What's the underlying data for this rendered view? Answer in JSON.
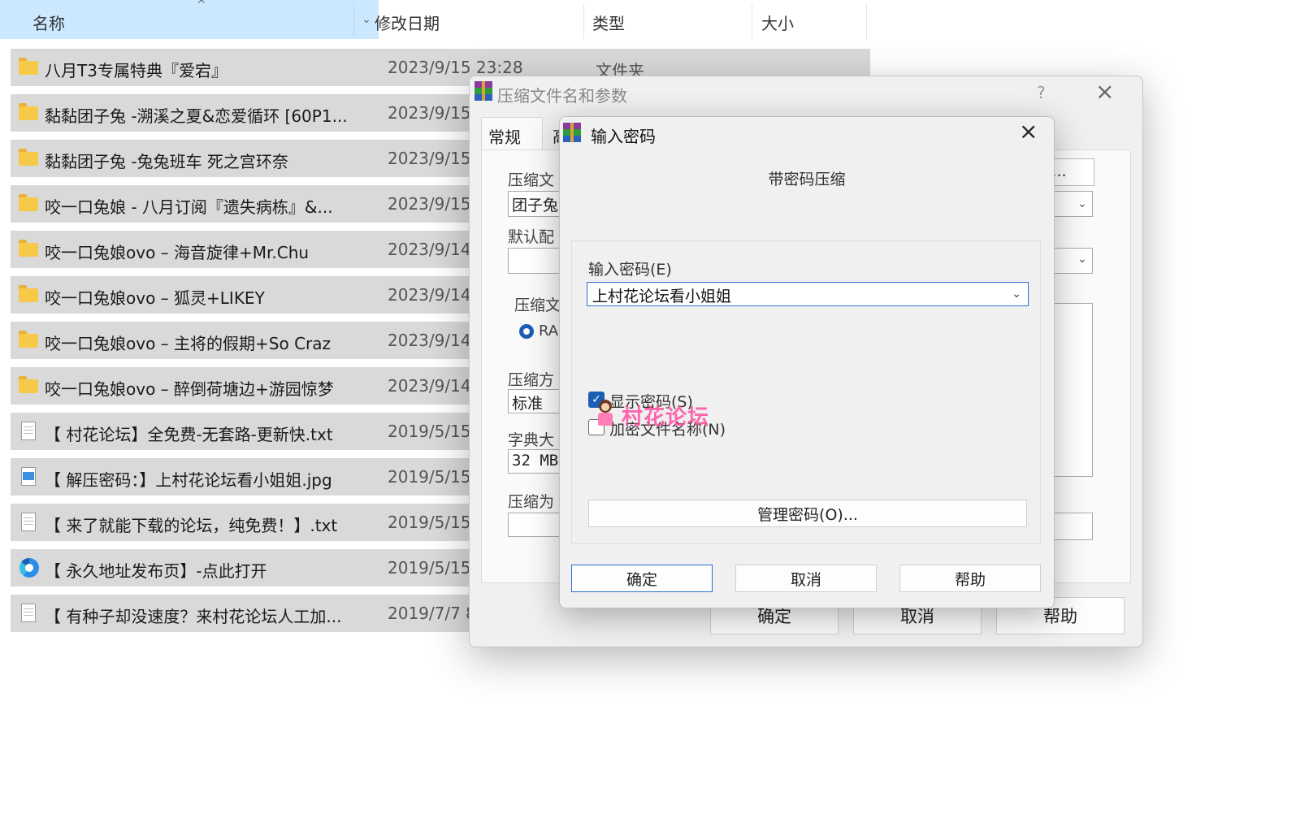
{
  "header": {
    "name": "名称",
    "date": "修改日期",
    "type": "类型",
    "size": "大小"
  },
  "files": [
    {
      "name": "八月T3专属特典『爱宕』",
      "date": "2023/9/15 23:28",
      "type": "文件夹",
      "icon": "folder-icon"
    },
    {
      "name": "黏黏团子兔 -溯溪之夏&恋爱循环 [60P1...",
      "date": "2023/9/15",
      "type": "",
      "icon": "folder-icon"
    },
    {
      "name": "黏黏团子兔 -兔兔班车 死之宫环奈",
      "date": "2023/9/15",
      "type": "",
      "icon": "folder-icon"
    },
    {
      "name": "咬一口兔娘 -  八月订阅『遗失病栋』&...",
      "date": "2023/9/15",
      "type": "",
      "icon": "folder-icon"
    },
    {
      "name": "咬一口兔娘ovo – 海音旋律+Mr.Chu",
      "date": "2023/9/14",
      "type": "",
      "icon": "folder-icon"
    },
    {
      "name": "咬一口兔娘ovo – 狐灵+LIKEY",
      "date": "2023/9/14",
      "type": "",
      "icon": "folder-icon"
    },
    {
      "name": "咬一口兔娘ovo – 主将的假期+So Craz",
      "date": "2023/9/14",
      "type": "",
      "icon": "folder-icon"
    },
    {
      "name": "咬一口兔娘ovo – 醉倒荷塘边+游园惊梦",
      "date": "2023/9/14",
      "type": "",
      "icon": "folder-icon"
    },
    {
      "name": "【 村花论坛】全免费-无套路-更新快.txt",
      "date": "2019/5/15",
      "type": "",
      "icon": "text-file-icon"
    },
    {
      "name": "【 解压密码：】上村花论坛看小姐姐.jpg",
      "date": "2019/5/15",
      "type": "",
      "icon": "image-file-icon"
    },
    {
      "name": "【 来了就能下载的论坛，纯免费！】.txt",
      "date": "2019/5/15",
      "type": "",
      "icon": "text-file-icon"
    },
    {
      "name": "【 永久地址发布页】-点此打开",
      "date": "2019/5/15",
      "type": "",
      "icon": "edge-shortcut-icon"
    },
    {
      "name": "【 有种子却没速度？来村花论坛人工加...",
      "date": "2019/7/7 8",
      "type": "",
      "icon": "text-file-icon"
    }
  ],
  "archive_dialog": {
    "title": "压缩文件名和参数",
    "help": "?",
    "tabs": [
      "常规",
      "高"
    ],
    "labels": {
      "archive_name": "压缩文",
      "default_profile": "默认配",
      "format": "压缩文",
      "method": "压缩方",
      "dict": "字典大",
      "split": "压缩为"
    },
    "values": {
      "archive_name": "团子兔",
      "format_option": "RA",
      "method": "标准",
      "dict": "32 MB",
      "browse_suffix": "B)..."
    },
    "buttons": {
      "ok": "确定",
      "cancel": "取消",
      "help": "帮助"
    }
  },
  "password_dialog": {
    "title": "输入密码",
    "heading": "带密码压缩",
    "password_label": "输入密码(E)",
    "password_value": "上村花论坛看小姐姐",
    "show_password": "显示密码(S)",
    "show_password_checked": true,
    "encrypt_names": "加密文件名称(N)",
    "encrypt_names_checked": false,
    "manage": "管理密码(O)...",
    "buttons": {
      "ok": "确定",
      "cancel": "取消",
      "help": "帮助"
    }
  },
  "watermark": "村花论坛"
}
